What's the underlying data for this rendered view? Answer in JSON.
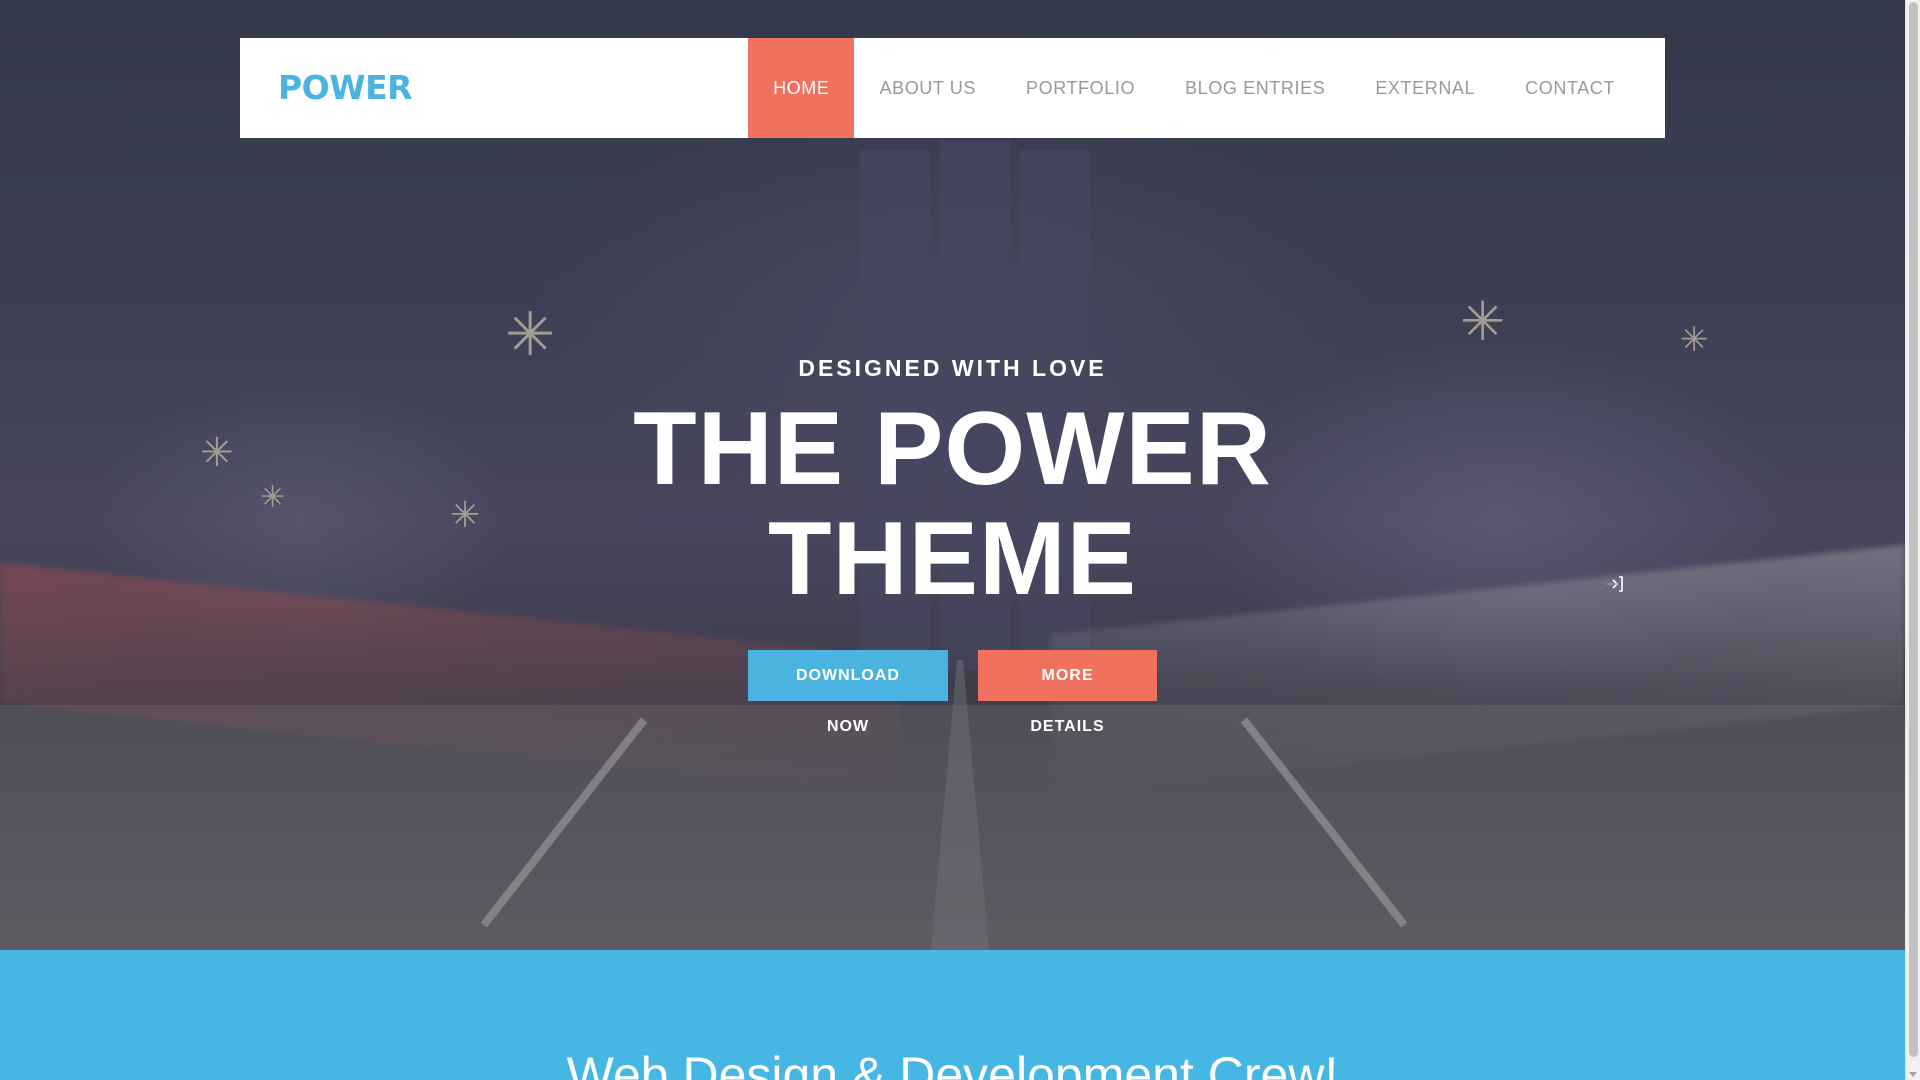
{
  "brand": {
    "logo_text": "POWER",
    "logo_color": "#4ab3df"
  },
  "nav": {
    "items": [
      {
        "label": "HOME",
        "active": true
      },
      {
        "label": "ABOUT US",
        "active": false
      },
      {
        "label": "PORTFOLIO",
        "active": false
      },
      {
        "label": "BLOG ENTRIES",
        "active": false
      },
      {
        "label": "EXTERNAL",
        "active": false
      },
      {
        "label": "CONTACT",
        "active": false
      }
    ],
    "active_color": "#f0715e"
  },
  "hero": {
    "tagline": "DESIGNED WITH LOVE",
    "title": "THE POWER THEME",
    "primary_button": "DOWNLOAD NOW",
    "secondary_button": "MORE DETAILS",
    "cursor_icon": "sign-in-cursor-icon"
  },
  "section": {
    "heading": "Web Design & Development Crew!",
    "background_color": "#46b7e2"
  },
  "colors": {
    "accent_blue": "#4ab3df",
    "accent_coral": "#f0715e"
  }
}
